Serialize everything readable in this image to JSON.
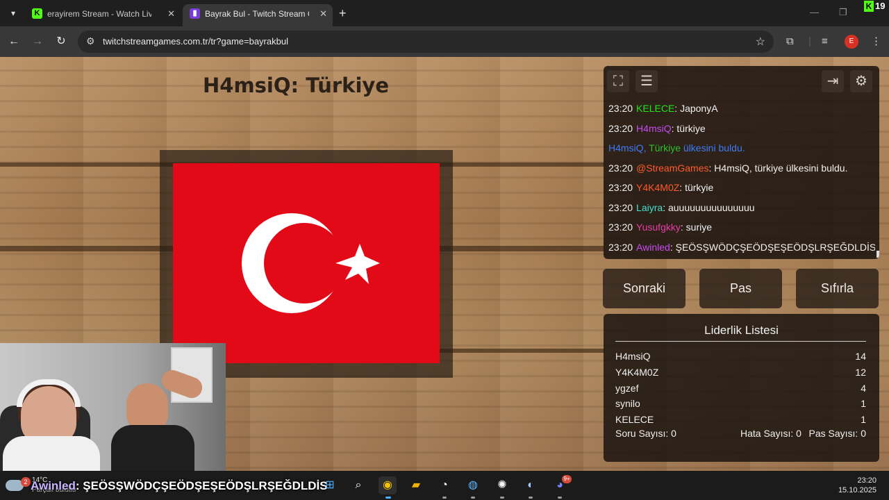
{
  "browser": {
    "tabs": [
      {
        "title": "erayirem Stream - Watch Live o",
        "favicon": "kick-icon",
        "active": false
      },
      {
        "title": "Bayrak Bul - Twitch Stream Gam",
        "favicon": "twitch-icon",
        "active": true
      }
    ],
    "url": "twitchstreamgames.com.tr/tr?game=bayrakbul",
    "profile_initial": "E",
    "brand_overlay": "19"
  },
  "game": {
    "title": "H4msiQ: Türkiye",
    "flag_country": "Türkiye",
    "buttons": {
      "next": "Sonraki",
      "pass": "Pas",
      "reset": "Sıfırla"
    }
  },
  "chat": {
    "messages": [
      {
        "time": "23:20",
        "user": "KELECE",
        "color": "#1fe61f",
        "text": ": JaponyA"
      },
      {
        "time": "23:20",
        "user": "H4msiQ",
        "color": "#c84bf0",
        "text": ": türkiye"
      },
      {
        "time": "23:20",
        "user": "@StreamGames",
        "color": "#ff5a2a",
        "text": ": H4msiQ, türkiye ülkesini buldu."
      },
      {
        "time": "23:20",
        "user": "Y4K4M0Z",
        "color": "#ff5a2a",
        "text": ": türkyie"
      },
      {
        "time": "23:20",
        "user": "Laiyra",
        "color": "#45e0d0",
        "text": ": auuuuuuuuuuuuuuu"
      },
      {
        "time": "23:20",
        "user": "Yusufgkky",
        "color": "#e83ea8",
        "text": ": suriye"
      },
      {
        "time": "23:20",
        "user": "Awinled",
        "color": "#c84bf0",
        "text": ": ŞEÖSŞWÖDÇŞEÖDŞEŞEÖDŞLRŞEĞDLDİS"
      }
    ],
    "system": {
      "user": "H4msiQ",
      "sep": ",",
      "country": "Türkiye",
      "text": "ülkesini buldu."
    }
  },
  "leaderboard": {
    "title": "Liderlik Listesi",
    "rows": [
      {
        "name": "H4msiQ",
        "score": "14"
      },
      {
        "name": "Y4K4M0Z",
        "score": "12"
      },
      {
        "name": "ygzef",
        "score": "4"
      },
      {
        "name": "synilo",
        "score": "1"
      },
      {
        "name": "KELECE",
        "score": "1"
      }
    ],
    "stats": {
      "questions": "Soru Sayısı: 0",
      "errors": "Hata Sayısı: 0",
      "passes": "Pas Sayısı: 0"
    }
  },
  "taskbar": {
    "weather_temp": "14°C",
    "weather_sub": "Parçalı bulutlu",
    "weather_badge": "2",
    "overlay_user": "Awinled",
    "overlay_text": ": ŞEÖSŞWÖDÇŞEÖDŞEŞEÖDŞLRŞEĞDLDİS",
    "time": "23:20",
    "date": "15.10.2025",
    "discord_badge": "9+"
  }
}
